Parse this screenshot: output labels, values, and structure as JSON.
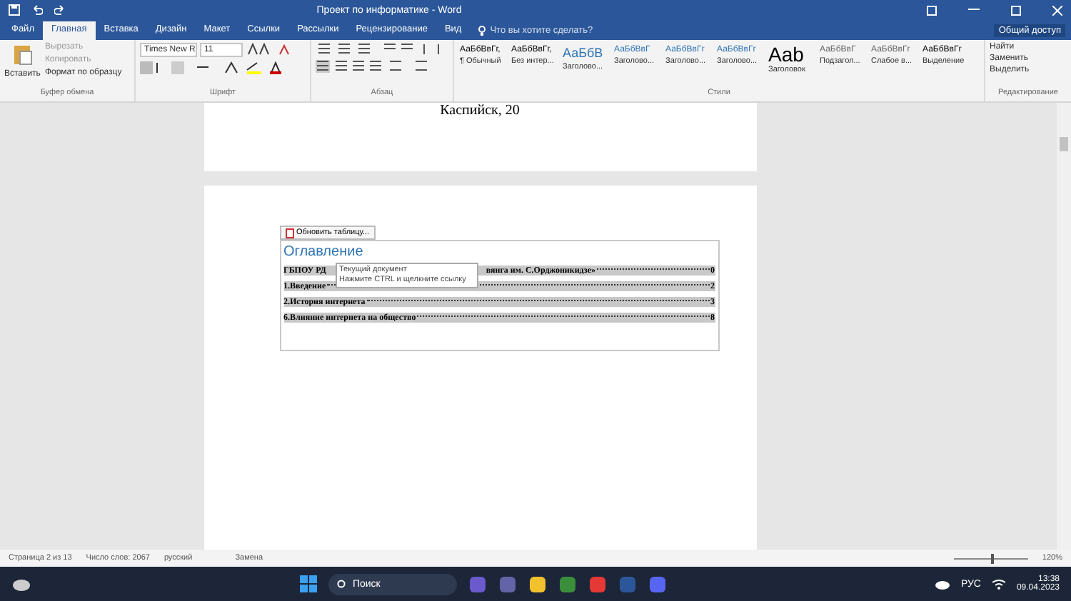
{
  "window": {
    "title": "Проект по информатике - Word",
    "share": "Общий доступ"
  },
  "tabs": [
    {
      "label": "Файл",
      "selected": false
    },
    {
      "label": "Главная",
      "selected": true
    },
    {
      "label": "Вставка",
      "selected": false
    },
    {
      "label": "Дизайн",
      "selected": false
    },
    {
      "label": "Макет",
      "selected": false
    },
    {
      "label": "Ссылки",
      "selected": false
    },
    {
      "label": "Рассылки",
      "selected": false
    },
    {
      "label": "Рецензирование",
      "selected": false
    },
    {
      "label": "Вид",
      "selected": false
    }
  ],
  "tell_me": {
    "placeholder": "Что вы хотите сделать?"
  },
  "clipboard": {
    "paste": "Вставить",
    "cut": "Вырезать",
    "copy": "Копировать",
    "format_painter": "Формат по образцу",
    "label": "Буфер обмена"
  },
  "font": {
    "name": "Times New R",
    "size": "11",
    "label": "Шрифт"
  },
  "paragraph": {
    "label": "Абзац"
  },
  "styles": {
    "label": "Стили",
    "items": [
      {
        "preview": "АаБбВвГг,",
        "name": "¶ Обычный",
        "kind": "normal"
      },
      {
        "preview": "АаБбВвГг,",
        "name": "Без интер...",
        "kind": "normal"
      },
      {
        "preview": "АаБбВ",
        "name": "Заголово...",
        "kind": "heading"
      },
      {
        "preview": "АаБбВвГ",
        "name": "Заголово...",
        "kind": "heading2"
      },
      {
        "preview": "АаБбВвГг",
        "name": "Заголово...",
        "kind": "heading2"
      },
      {
        "preview": "АаБбВвГг",
        "name": "Заголово...",
        "kind": "heading2"
      },
      {
        "preview": "Aab",
        "name": "Заголовок",
        "kind": "title"
      },
      {
        "preview": "АаБбВвГ",
        "name": "Подзагол...",
        "kind": "subtle"
      },
      {
        "preview": "АаБбВвГг",
        "name": "Слабое в...",
        "kind": "subtle"
      },
      {
        "preview": "АаБбВвГг",
        "name": "Выделение",
        "kind": "normal"
      }
    ]
  },
  "editing": {
    "find": "Найти",
    "replace": "Заменить",
    "select": "Выделить",
    "label": "Редактирование"
  },
  "page1": {
    "text": "Каспийск, 20"
  },
  "toc": {
    "update_button": "Обновить таблицу...",
    "heading": "Оглавление",
    "entries": [
      {
        "text": "ГБПОУ РД",
        "text_after": "вянга им. С.Орджоникидзе»",
        "page": "0"
      },
      {
        "text": "1.Введение",
        "page": "2"
      },
      {
        "text": "2.История интернета",
        "page": "3"
      },
      {
        "text": "6.Влияние интернета на общество",
        "page": "8"
      }
    ],
    "tooltip": [
      "Текущий документ",
      "Нажмите CTRL и щелкните ссылку"
    ]
  },
  "status_bar": {
    "page": "Страница 2 из 13",
    "words": "Число слов: 2067",
    "language": "русский",
    "mode": "Замена",
    "zoom": "120%",
    "zoom_slider": {
      "level": 0.5
    }
  },
  "taskbar": {
    "search": "Поиск",
    "language": "РУС",
    "time": "13:38",
    "date": "09.04.2023"
  }
}
